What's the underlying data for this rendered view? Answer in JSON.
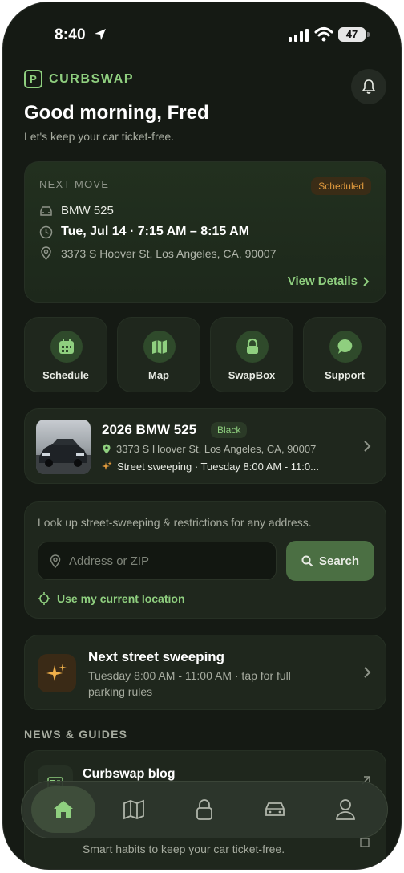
{
  "status_bar": {
    "time": "8:40",
    "battery": "47"
  },
  "brand": {
    "name": "CURBSWAP",
    "logo_letter": "P"
  },
  "header": {
    "greeting": "Good morning, Fred",
    "subtitle": "Let's keep your car ticket-free."
  },
  "next_move": {
    "label": "NEXT MOVE",
    "badge": "Scheduled",
    "car": "BMW 525",
    "datetime": "Tue, Jul 14 · 7:15 AM – 8:15 AM",
    "address": "3373 S Hoover St, Los Angeles, CA, 90007",
    "view_details": "View Details"
  },
  "quick_actions": [
    {
      "label": "Schedule",
      "icon": "calendar-icon"
    },
    {
      "label": "Map",
      "icon": "map-icon"
    },
    {
      "label": "SwapBox",
      "icon": "lock-icon"
    },
    {
      "label": "Support",
      "icon": "chat-bubble-icon"
    }
  ],
  "vehicle": {
    "title": "2026 BMW 525",
    "color_chip": "Black",
    "address": "3373 S Hoover St, Los Angeles, CA, 90007",
    "sweeping": "Street sweeping · Tuesday 8:00 AM - 11:0..."
  },
  "lookup": {
    "text": "Look up street-sweeping & restrictions for any address.",
    "placeholder": "Address or ZIP",
    "search_label": "Search",
    "use_location": "Use my current location"
  },
  "next_sweeping": {
    "title": "Next street sweeping",
    "description": "Tuesday 8:00 AM - 11:00 AM · tap for full parking rules"
  },
  "news": {
    "heading": "NEWS & GUIDES",
    "item_title": "Curbswap blog",
    "item_desc": "Smart habits to keep your car ticket-free."
  },
  "tab_bar": [
    "home-icon",
    "map-icon",
    "lock-icon",
    "car-icon",
    "profile-icon"
  ],
  "colors": {
    "accent": "#8fcf7f",
    "background": "#151a14",
    "card": "#1f271d",
    "badge": "#e09a3d"
  }
}
